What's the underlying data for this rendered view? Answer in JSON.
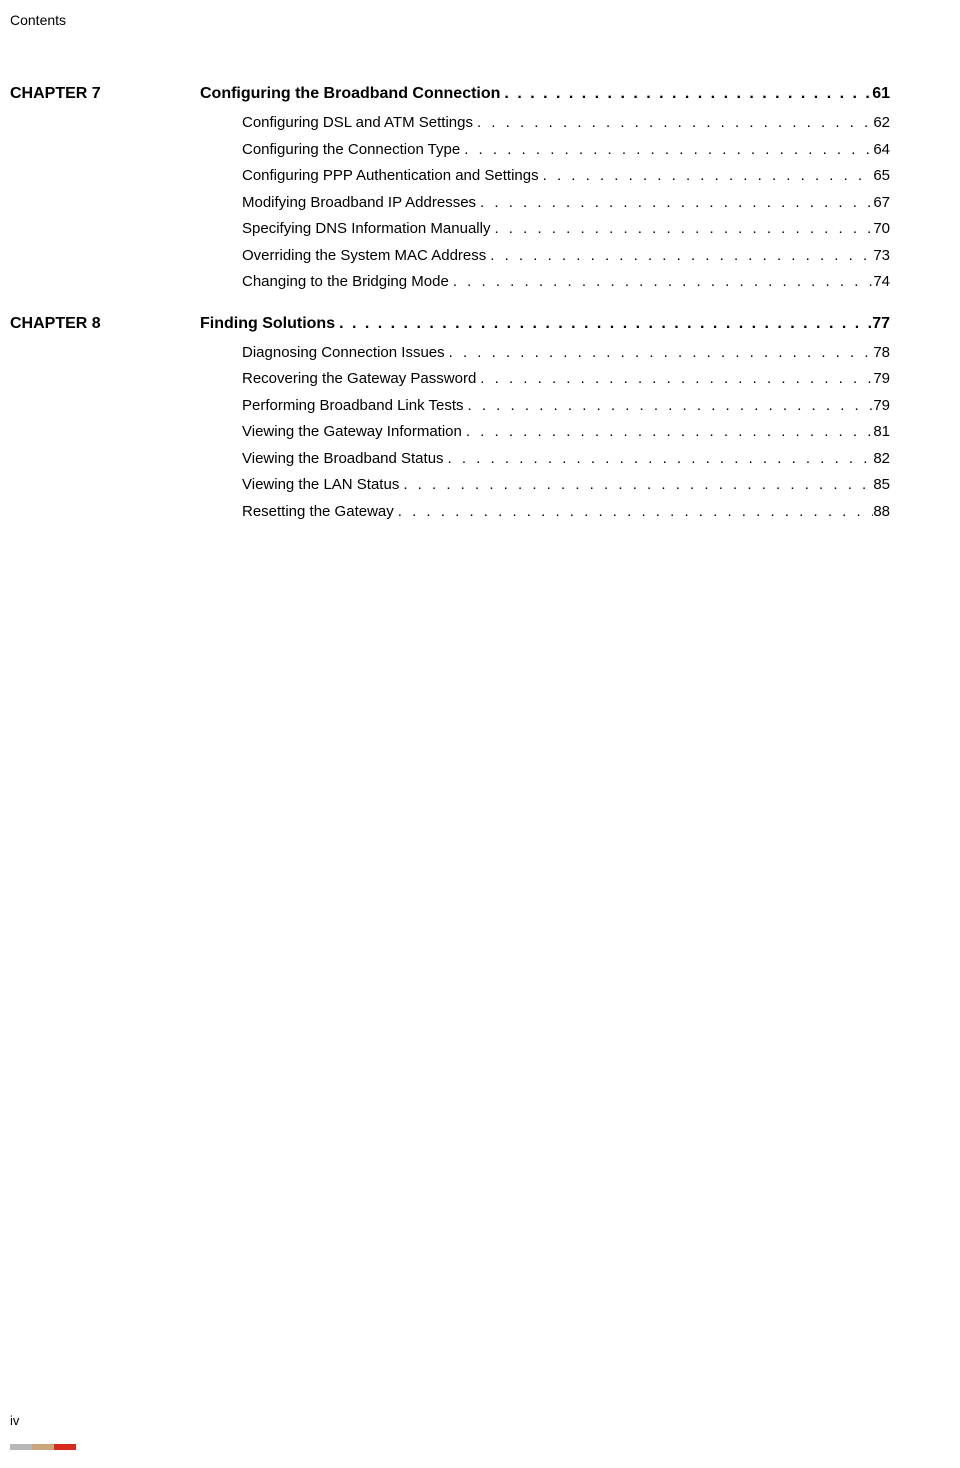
{
  "header": {
    "label": "Contents"
  },
  "chapters": [
    {
      "label": "CHAPTER 7",
      "title": "Configuring the Broadband Connection",
      "page": "61",
      "entries": [
        {
          "title": "Configuring DSL and ATM Settings",
          "page": "62"
        },
        {
          "title": "Configuring the Connection Type",
          "page": "64"
        },
        {
          "title": "Configuring PPP Authentication and Settings",
          "page": "65"
        },
        {
          "title": "Modifying Broadband IP Addresses",
          "page": "67"
        },
        {
          "title": "Specifying DNS Information Manually",
          "page": "70"
        },
        {
          "title": "Overriding the System MAC Address",
          "page": "73"
        },
        {
          "title": "Changing to the Bridging Mode",
          "page": "74"
        }
      ]
    },
    {
      "label": "CHAPTER 8",
      "title": "Finding Solutions",
      "page": "77",
      "entries": [
        {
          "title": "Diagnosing Connection Issues",
          "page": "78"
        },
        {
          "title": "Recovering the Gateway Password",
          "page": "79"
        },
        {
          "title": "Performing Broadband Link Tests",
          "page": "79"
        },
        {
          "title": "Viewing the Gateway Information",
          "page": "81"
        },
        {
          "title": "Viewing the Broadband Status",
          "page": "82"
        },
        {
          "title": "Viewing the LAN Status",
          "page": "85"
        },
        {
          "title": "Resetting the Gateway",
          "page": "88"
        }
      ]
    }
  ],
  "footer": {
    "page_number": "iv"
  },
  "dots": ". . . . . . . . . . . . . . . . . . . . . . . . . . . . . . . . . . . . . . . . . . . . . . . . . . . . . . . . . . . . . . . . . . . . . . . ."
}
